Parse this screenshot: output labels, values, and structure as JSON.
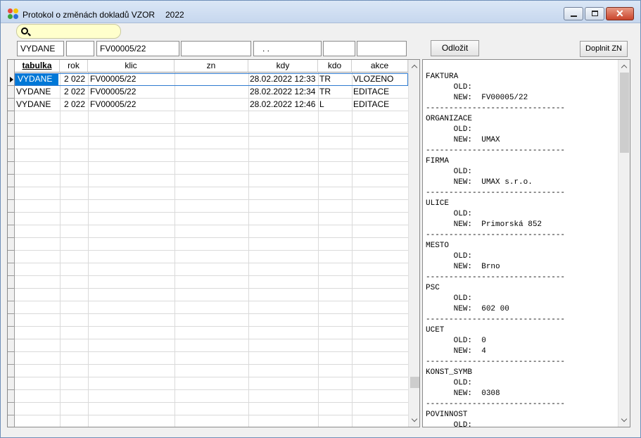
{
  "window": {
    "title": "Protokol o změnách dokladů VZOR",
    "year": "2022"
  },
  "filters": {
    "tabulka": "VYDANE",
    "rok": "",
    "klic": "FV00005/22",
    "zn": "",
    "kdy": ". .",
    "kdo": "",
    "akce": ""
  },
  "buttons": {
    "odlozit": "Odložit",
    "doplnit": "Doplnit ZN"
  },
  "grid": {
    "columns": [
      "tabulka",
      "rok",
      "klic",
      "zn",
      "kdy",
      "kdo",
      "akce"
    ],
    "rows": [
      {
        "tabulka": "VYDANE",
        "rok": "2 022",
        "klic": "FV00005/22",
        "zn": "",
        "kdy": "28.02.2022 12:33",
        "kdo": "TR",
        "akce": "VLOZENO"
      },
      {
        "tabulka": "VYDANE",
        "rok": "2 022",
        "klic": "FV00005/22",
        "zn": "",
        "kdy": "28.02.2022 12:34",
        "kdo": "TR",
        "akce": "EDITACE"
      },
      {
        "tabulka": "VYDANE",
        "rok": "2 022",
        "klic": "FV00005/22",
        "zn": "",
        "kdy": "28.02.2022 12:46",
        "kdo": "L",
        "akce": "EDITACE"
      }
    ]
  },
  "detail": {
    "text": "FAKTURA\n      OLD:\n      NEW:  FV00005/22\n------------------------------\nORGANIZACE\n      OLD:\n      NEW:  UMAX\n------------------------------\nFIRMA\n      OLD:\n      NEW:  UMAX s.r.o.\n------------------------------\nULICE\n      OLD:\n      NEW:  Primorská 852\n------------------------------\nMESTO\n      OLD:\n      NEW:  Brno\n------------------------------\nPSC\n      OLD:\n      NEW:  602 00\n------------------------------\nUCET\n      OLD:  0\n      NEW:  4\n------------------------------\nKONST_SYMB\n      OLD:\n      NEW:  0308\n------------------------------\nPOVINNOST\n      OLD:"
  }
}
